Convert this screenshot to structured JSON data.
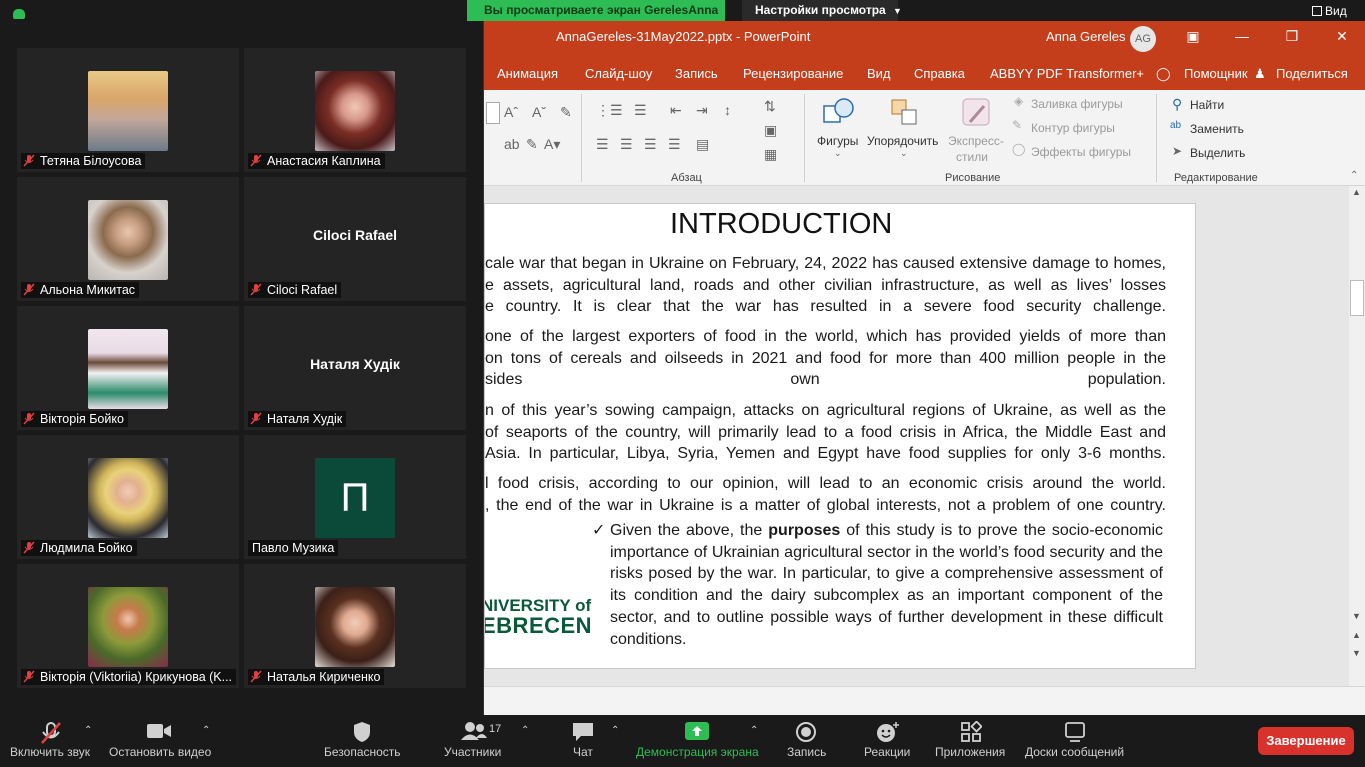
{
  "zoom": {
    "banner": "Вы просматриваете экран GerelesAnna",
    "view_settings": "Настройки просмотра",
    "view_button": "Вид",
    "participants_count": "17",
    "toolbar": {
      "unmute": "Включить звук",
      "stop_video": "Остановить видео",
      "security": "Безопасность",
      "participants": "Участники",
      "chat": "Чат",
      "share_screen": "Демонстрация экрана",
      "record": "Запись",
      "reactions": "Реакции",
      "apps": "Приложения",
      "whiteboards": "Доски сообщений",
      "end": "Завершение"
    },
    "participants": [
      {
        "name": "Тетяна Білоусова",
        "muted": true,
        "display": "photo"
      },
      {
        "name": "Анастасия Каплина",
        "muted": true,
        "display": "photo"
      },
      {
        "name": "Альона Микитас",
        "muted": true,
        "display": "photo"
      },
      {
        "name": "Ciloci Rafael",
        "muted": true,
        "display": "name",
        "big_name": "Ciloci Rafael"
      },
      {
        "name": "Вікторія Бойко",
        "muted": true,
        "display": "photo"
      },
      {
        "name": "Наталя Худік",
        "muted": true,
        "display": "name",
        "big_name": "Наталя Худік"
      },
      {
        "name": "Людмила Бойко",
        "muted": true,
        "display": "photo"
      },
      {
        "name": "Павло Музика",
        "muted": false,
        "display": "letter",
        "letter": "П"
      },
      {
        "name": "Вікторія (Viktoriia) Крикунова (K...",
        "muted": true,
        "display": "photo"
      },
      {
        "name": "Наталья Кириченко",
        "muted": true,
        "display": "photo"
      }
    ]
  },
  "powerpoint": {
    "filename": "AnnaGereles-31May2022.pptx  -  PowerPoint",
    "user": "Anna Gereles",
    "avatar_initials": "AG",
    "menu": [
      "Анимация",
      "Слайд-шоу",
      "Запись",
      "Рецензирование",
      "Вид",
      "Справка",
      "ABBYY PDF Transformer+",
      "Помощник",
      "Поделиться"
    ],
    "ribbon": {
      "paragraph_label": "Абзац",
      "drawing_label": "Рисование",
      "editing_label": "Редактирование",
      "shapes": "Фигуры",
      "arrange": "Упорядочить",
      "quick_styles_1": "Экспресс-",
      "quick_styles_2": "стили",
      "shape_fill": "Заливка фигуры",
      "shape_outline": "Контур фигуры",
      "shape_effects": "Эффекты фигуры",
      "find": "Найти",
      "replace": "Заменить",
      "select": "Выделить"
    },
    "slide": {
      "title": "INTRODUCTION",
      "p1": [
        "cale war that began in Ukraine on February, 24, 2022 has caused extensive damage to homes,",
        "e assets, agricultural land, roads and other civilian infrastructure, as well as lives’ losses",
        "e country. It is clear that the war has resulted in a severe food security challenge."
      ],
      "p2": [
        "one of the largest exporters of food in the world, which has provided yields of more than",
        "on tons of cereals and oilseeds in 2021 and food for more than 400 million people in the",
        "sides own population."
      ],
      "p3": [
        "n of this year’s sowing campaign, attacks on agricultural regions of Ukraine, as well as the",
        "of seaports of the country, will primarily lead to a food crisis in Africa, the Middle East and",
        "Asia. In particular, Libya, Syria, Yemen and Egypt have food supplies for only 3-6 months."
      ],
      "p4": [
        "l food crisis, according to our opinion, will lead to an economic crisis around the world.",
        ", the end of the war in Ukraine is a matter of global interests, not a problem of one country."
      ],
      "purpose_prefix": "Given the above, the ",
      "purpose_bold": "purposes",
      "purpose_rest": " of this study is to prove the socio-economic importance of Ukrainian agricultural sector in the world’s food security and the risks posed by the war. In particular, to give a comprehensive assessment of its condition and the dairy subcomplex as an important component of the sector, and to outline possible ways of further development in these difficult conditions.",
      "logo_line1": "NIVERSITY of",
      "logo_line2": "EBRECEN"
    }
  }
}
